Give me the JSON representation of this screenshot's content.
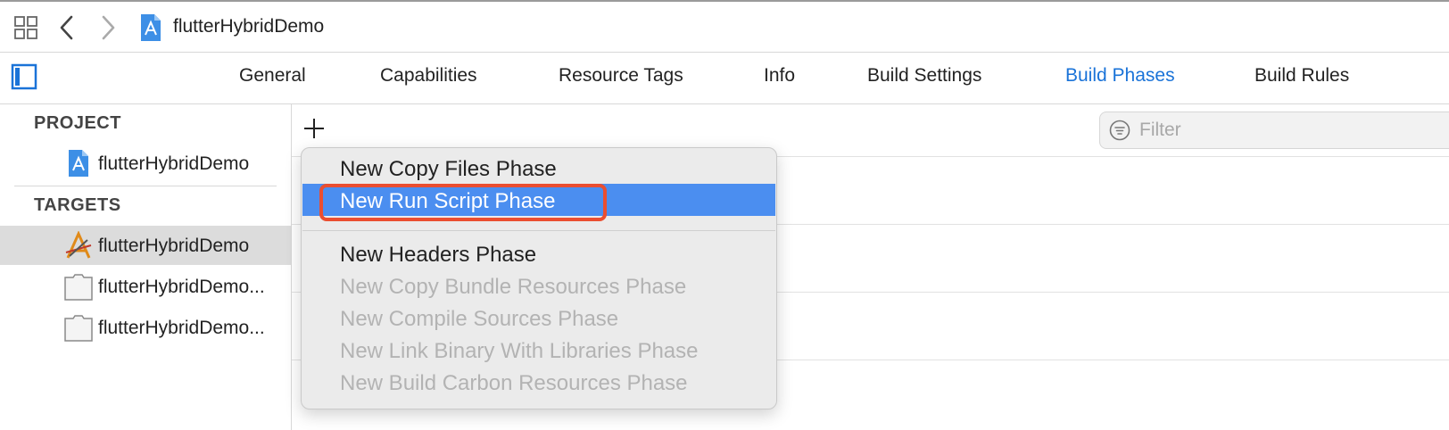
{
  "toolbar": {
    "project_title": "flutterHybridDemo",
    "icons": [
      "grid-icon",
      "back-arrow-icon",
      "forward-arrow-icon",
      "project-file-icon"
    ]
  },
  "tabs": [
    {
      "label": "General",
      "active": false
    },
    {
      "label": "Capabilities",
      "active": false
    },
    {
      "label": "Resource Tags",
      "active": false
    },
    {
      "label": "Info",
      "active": false
    },
    {
      "label": "Build Settings",
      "active": false
    },
    {
      "label": "Build Phases",
      "active": true
    },
    {
      "label": "Build Rules",
      "active": false
    }
  ],
  "sidebar": {
    "project_header": "PROJECT",
    "project_item": "flutterHybridDemo",
    "targets_header": "TARGETS",
    "targets": [
      {
        "label": "flutterHybridDemo",
        "selected": true,
        "icon": "app-target-icon"
      },
      {
        "label": "flutterHybridDemo...",
        "selected": false,
        "icon": "test-bundle-icon"
      },
      {
        "label": "flutterHybridDemo...",
        "selected": false,
        "icon": "test-bundle-icon"
      }
    ]
  },
  "main": {
    "filter_placeholder": "Filter"
  },
  "menu": {
    "items": [
      {
        "label": "New Copy Files Phase",
        "enabled": true,
        "highlighted": false
      },
      {
        "label": "New Run Script Phase",
        "enabled": true,
        "highlighted": true
      },
      {
        "label": "New Headers Phase",
        "enabled": true,
        "highlighted": false
      },
      {
        "label": "New Copy Bundle Resources Phase",
        "enabled": false,
        "highlighted": false
      },
      {
        "label": "New Compile Sources Phase",
        "enabled": false,
        "highlighted": false
      },
      {
        "label": "New Link Binary With Libraries Phase",
        "enabled": false,
        "highlighted": false
      },
      {
        "label": "New Build Carbon Resources Phase",
        "enabled": false,
        "highlighted": false
      }
    ]
  },
  "colors": {
    "accent": "#1a73d8",
    "menu_highlight": "#4b8ef0",
    "annotation_box": "#ea4e30",
    "sidebar_selection": "#dcdcdc"
  }
}
